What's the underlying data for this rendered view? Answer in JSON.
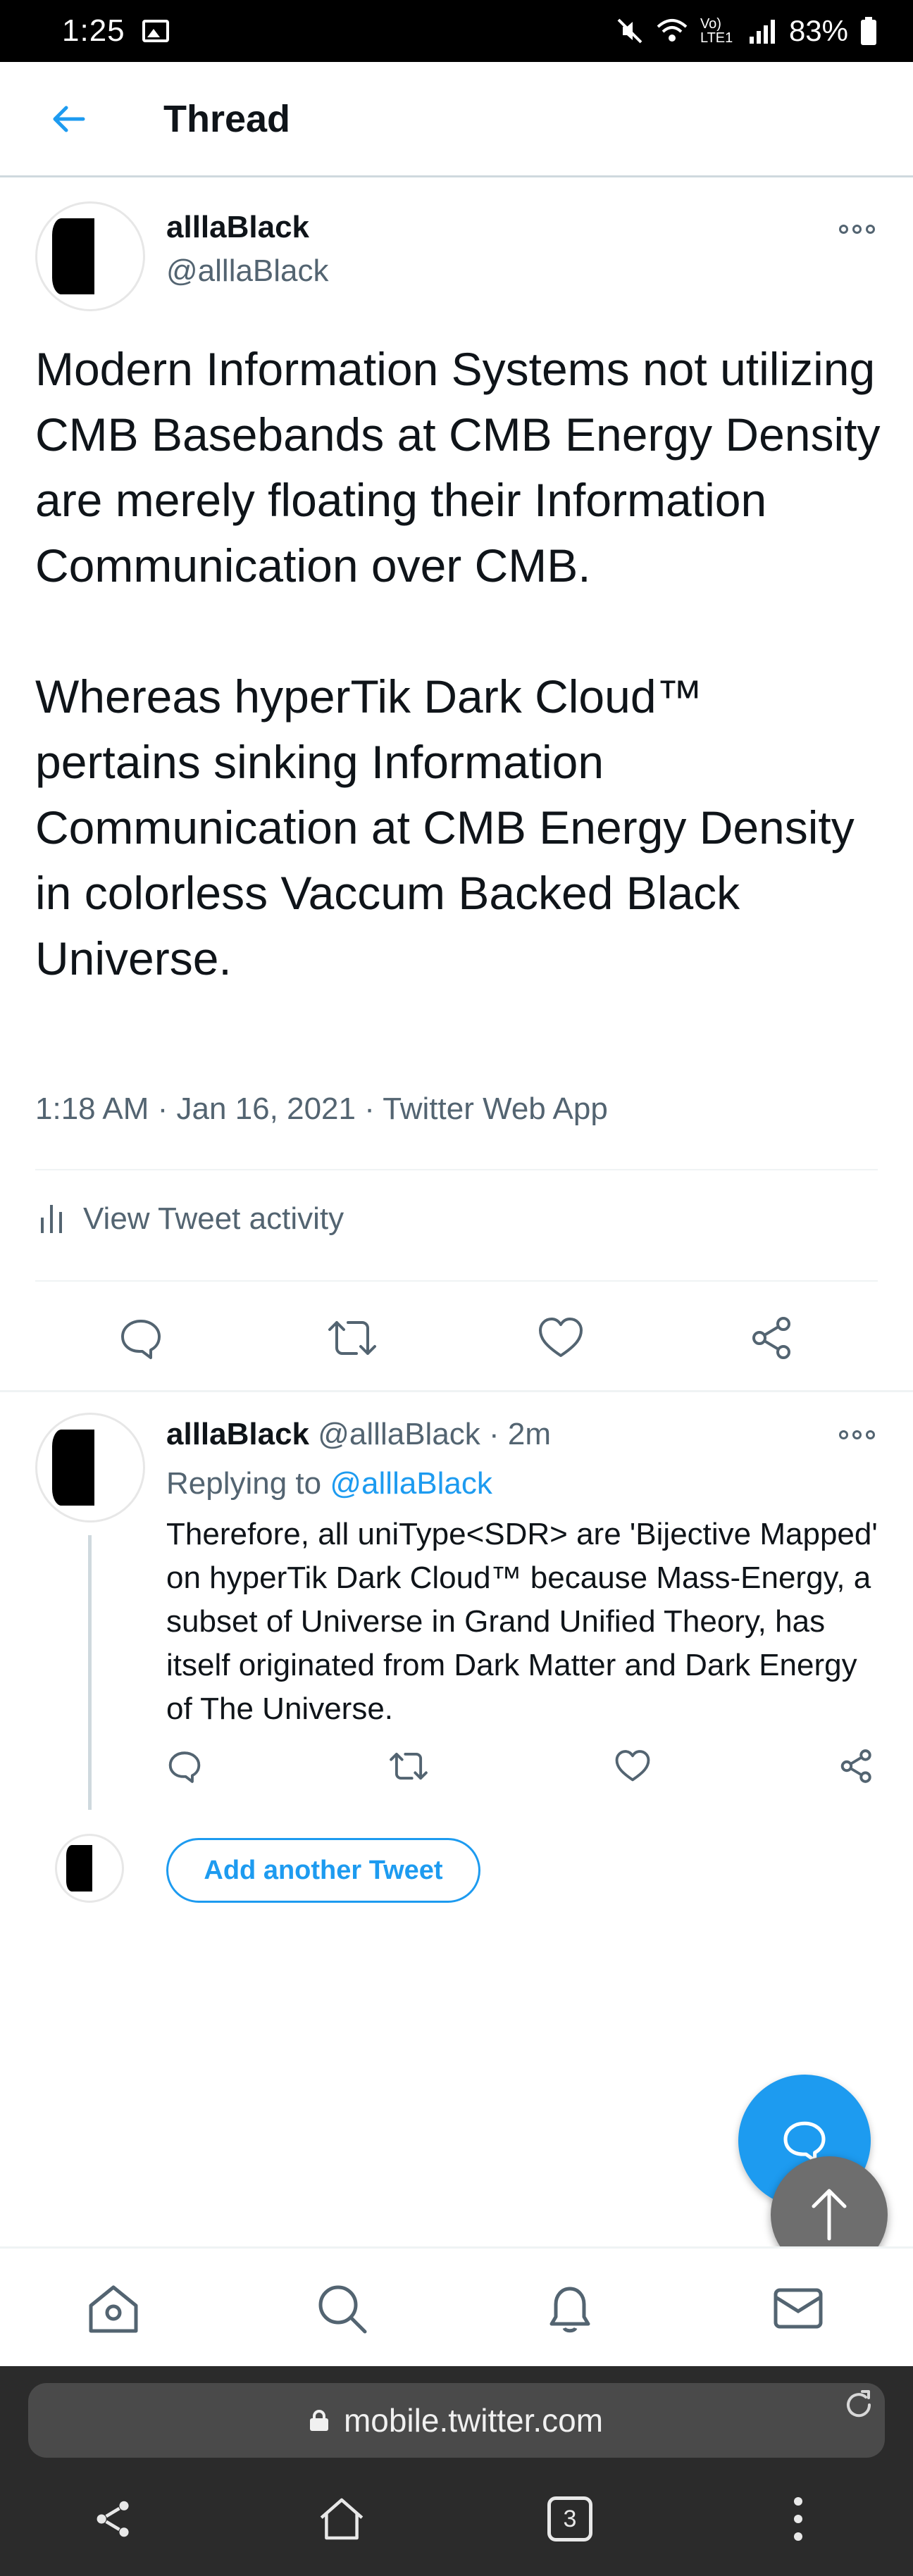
{
  "status_bar": {
    "time": "1:25",
    "network": "Vo) LTE1",
    "battery": "83%"
  },
  "header": {
    "title": "Thread",
    "back_icon": "arrow-left-icon"
  },
  "main_tweet": {
    "author_name": "alllaBlack",
    "author_handle": "@alllaBlack",
    "text": "Modern Information Systems not utilizing CMB Basebands at CMB Energy Density are merely floating their Information Communication over CMB.\n\nWhereas hyperTik Dark Cloud™ pertains sinking Information Communication at CMB Energy Density in colorless Vaccum Backed Black Universe.",
    "meta": "1:18 AM · Jan 16, 2021 · Twitter Web App",
    "activity_label": "View Tweet activity"
  },
  "reply_tweet": {
    "author_name": "alllaBlack",
    "author_handle": "@alllaBlack",
    "time": "· 2m",
    "replying_prefix": "Replying to",
    "replying_to": "@alllaBlack",
    "text": "Therefore, all uniType<SDR> are 'Bijective Mapped' on hyperTik Dark Cloud™ because Mass-Energy, a subset of Universe in Grand Unified Theory, has itself originated from Dark Matter and Dark Energy of The Universe."
  },
  "add_tweet_label": "Add another Tweet",
  "browser": {
    "url": "mobile.twitter.com",
    "tabs_count": "3"
  },
  "colors": {
    "accent": "#1d9bf0",
    "text": "#0f1419",
    "secondary": "#536471"
  }
}
